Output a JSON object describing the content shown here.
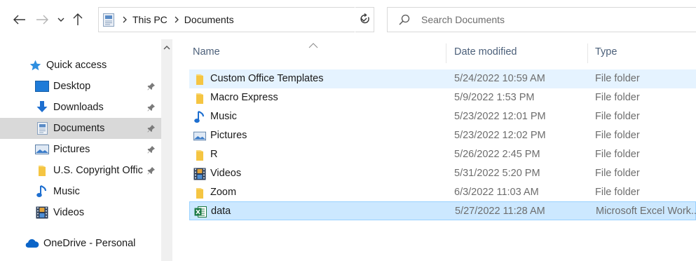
{
  "window": {
    "breadcrumbs": [
      "This PC",
      "Documents"
    ]
  },
  "search": {
    "placeholder": "Search Documents"
  },
  "navigation": {
    "items": [
      {
        "label": "Quick access",
        "icon": "star-icon",
        "pinned": false,
        "selected": false
      },
      {
        "label": "Desktop",
        "icon": "desktop-icon",
        "pinned": true,
        "selected": false
      },
      {
        "label": "Downloads",
        "icon": "download-arrow-icon",
        "pinned": true,
        "selected": false
      },
      {
        "label": "Documents",
        "icon": "documents-icon",
        "pinned": true,
        "selected": true
      },
      {
        "label": "Pictures",
        "icon": "pictures-icon",
        "pinned": true,
        "selected": false
      },
      {
        "label": "U.S. Copyright Offic",
        "icon": "folder-icon",
        "pinned": true,
        "selected": false
      },
      {
        "label": "Music",
        "icon": "music-note-icon",
        "pinned": false,
        "selected": false
      },
      {
        "label": "Videos",
        "icon": "videos-icon",
        "pinned": false,
        "selected": false
      },
      {
        "label": "OneDrive - Personal",
        "icon": "cloud-icon",
        "pinned": false,
        "selected": false
      }
    ]
  },
  "file_list": {
    "columns": {
      "name": "Name",
      "date": "Date modified",
      "type": "Type"
    },
    "rows": [
      {
        "name": "Custom Office Templates",
        "date": "5/24/2022 10:59 AM",
        "type": "File folder",
        "icon": "folder-icon",
        "state": "hover"
      },
      {
        "name": "Macro Express",
        "date": "5/9/2022 1:53 PM",
        "type": "File folder",
        "icon": "folder-icon",
        "state": "normal"
      },
      {
        "name": "Music",
        "date": "5/23/2022 12:01 PM",
        "type": "File folder",
        "icon": "music-note-icon",
        "state": "normal"
      },
      {
        "name": "Pictures",
        "date": "5/23/2022 12:02 PM",
        "type": "File folder",
        "icon": "pictures-icon",
        "state": "normal"
      },
      {
        "name": "R",
        "date": "5/26/2022 2:45 PM",
        "type": "File folder",
        "icon": "folder-icon",
        "state": "normal"
      },
      {
        "name": "Videos",
        "date": "5/31/2022 5:20 PM",
        "type": "File folder",
        "icon": "videos-icon",
        "state": "normal"
      },
      {
        "name": "Zoom",
        "date": "6/3/2022 11:03 AM",
        "type": "File folder",
        "icon": "folder-icon",
        "state": "normal"
      },
      {
        "name": "data",
        "date": "5/27/2022 11:28 AM",
        "type": "Microsoft Excel Work...",
        "icon": "excel-file-icon",
        "state": "selected"
      }
    ]
  },
  "colors": {
    "accent": "#0078d4",
    "folder": "#f8d775",
    "hover_row": "#e5f3ff",
    "selected_row": "#cce8ff",
    "nav_selected": "#d9d9d9"
  }
}
